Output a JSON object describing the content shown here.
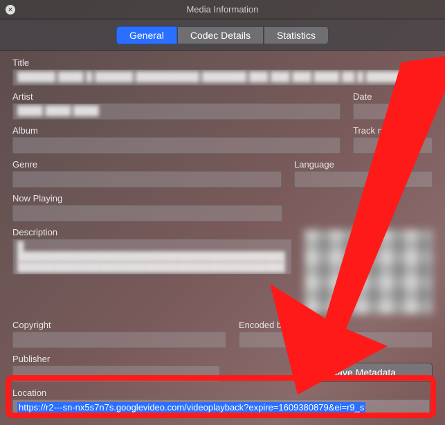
{
  "title": "Media Information",
  "tabs": {
    "general": "General",
    "codec": "Codec Details",
    "stats": "Statistics"
  },
  "labels": {
    "title": "Title",
    "artist": "Artist",
    "date": "Date",
    "album": "Album",
    "track": "Track number",
    "genre": "Genre",
    "language": "Language",
    "now": "Now Playing",
    "desc": "Description",
    "copyright": "Copyright",
    "enc": "Encoded by",
    "publisher": "Publisher",
    "location": "Location"
  },
  "values": {
    "title": "██████ ████ █ ██████ ██████████ ███████ ███ ███ ███ ████ ██ █ ████████",
    "artist": "████ ████ ████",
    "date": "",
    "album": "",
    "track": "",
    "genre": "",
    "language": "",
    "now": "",
    "desc_line1": "█ ██████████████████████████████████████████",
    "desc_line2": "██████████████████████████████████████████",
    "copyright": "",
    "encoded": "",
    "publisher": ""
  },
  "buttons": {
    "save": "Save Metadata"
  },
  "location": "https://r2---sn-nx5s7n7s.googlevideo.com/videoplayback?expire=1609380879&ei=r9_s"
}
